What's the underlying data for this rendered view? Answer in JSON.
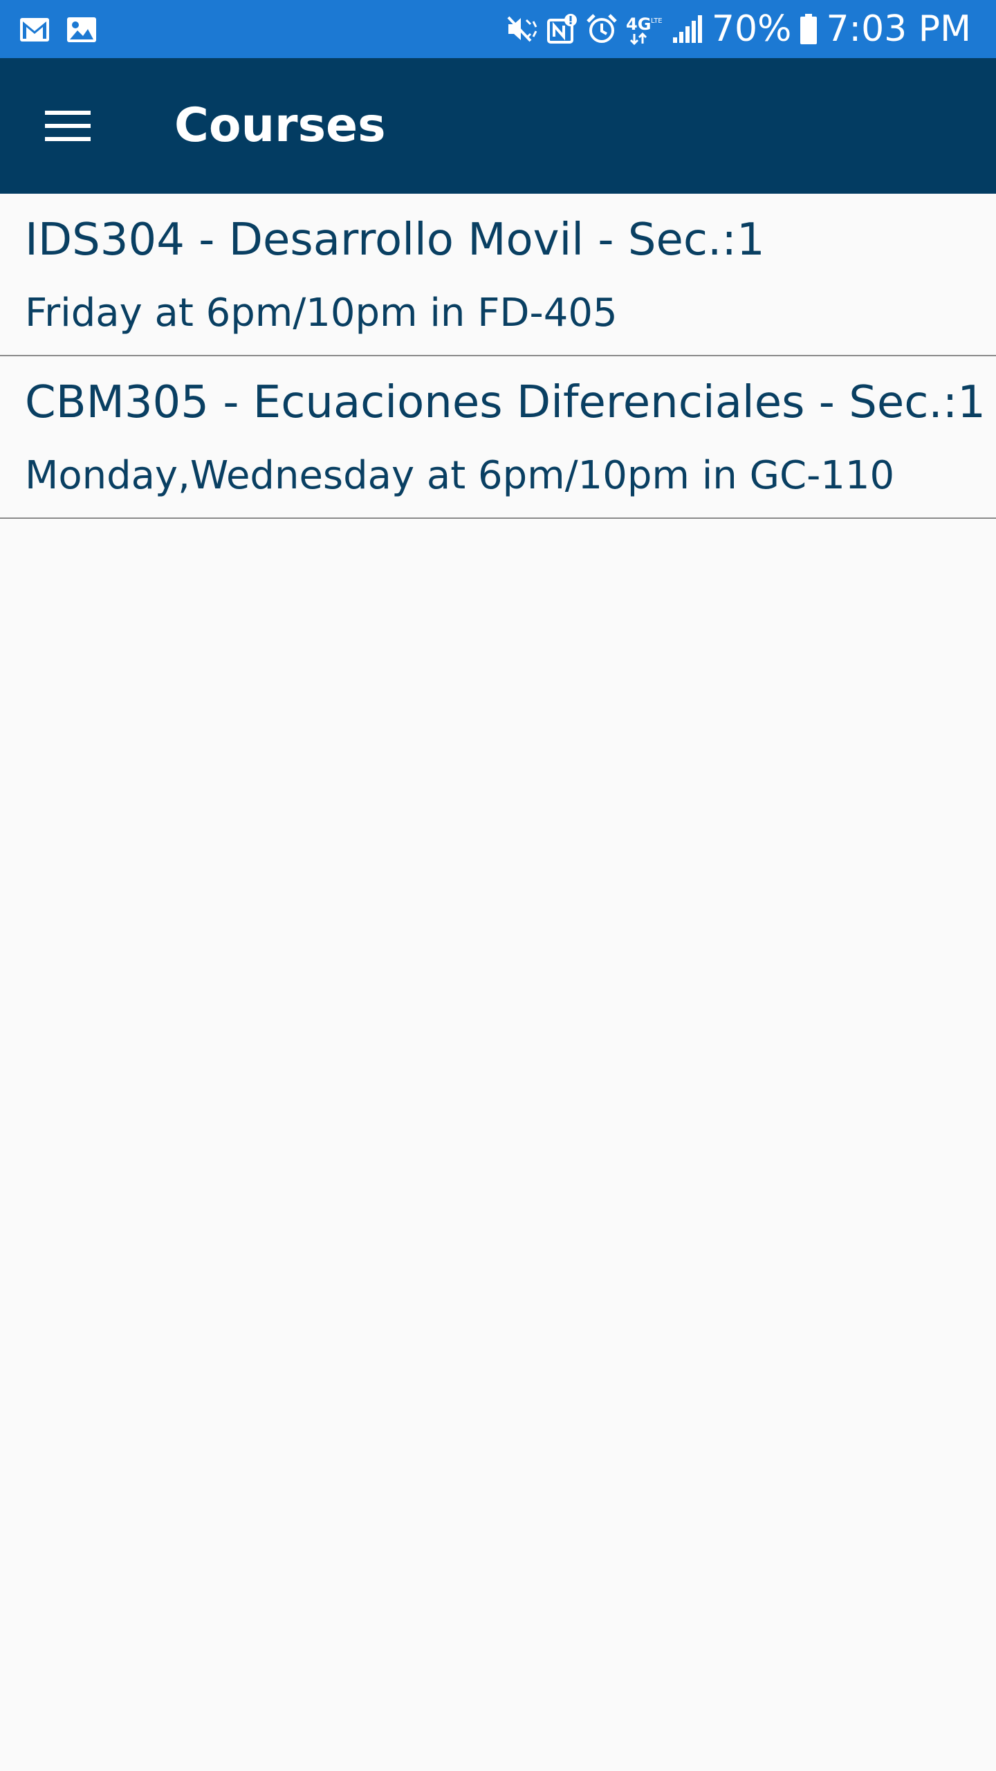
{
  "status_bar": {
    "background": "#1c79d3",
    "left_icons": [
      "gmail-icon",
      "gallery-icon"
    ],
    "right_icons": [
      "mute-icon",
      "nfc-icon",
      "alarm-icon",
      "4g-lte-icon",
      "signal-icon"
    ],
    "battery_percent": "70%",
    "battery_icon": "battery-icon",
    "time": "7:03 PM"
  },
  "app_bar": {
    "background": "#033c62",
    "menu_icon": "hamburger-menu-icon",
    "title": "Courses"
  },
  "courses": [
    {
      "name": "IDS304 - Desarrollo Movil - Sec.:1",
      "schedule": "Friday at 6pm/10pm in FD-405"
    },
    {
      "name": "CBM305 - Ecuaciones Diferenciales - Sec.:1",
      "schedule": "Monday,Wednesday at 6pm/10pm in GC-110"
    }
  ],
  "colors": {
    "text": "#093f62",
    "background": "#fafafa",
    "divider": "#8a8a8a"
  }
}
